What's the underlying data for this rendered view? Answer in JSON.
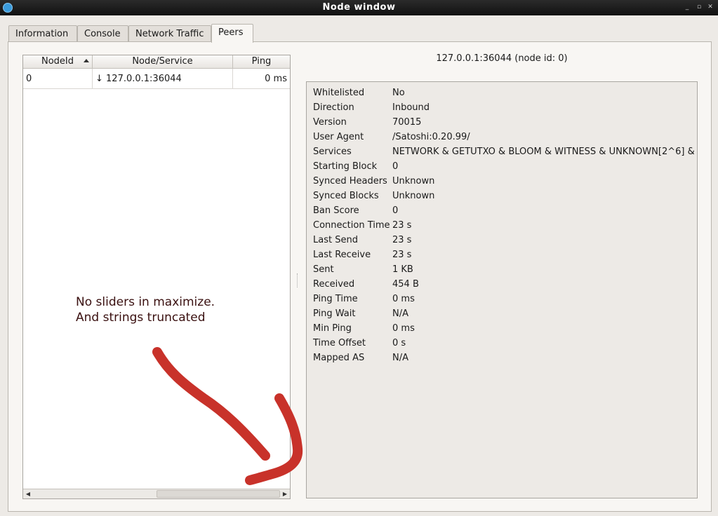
{
  "window": {
    "title": "Node window",
    "controls": [
      "_",
      "▫",
      "✕"
    ]
  },
  "tabs": [
    {
      "label": "Information"
    },
    {
      "label": "Console"
    },
    {
      "label": "Network Traffic"
    },
    {
      "label": "Peers"
    }
  ],
  "peers_table": {
    "columns": [
      "NodeId",
      "Node/Service",
      "Ping"
    ],
    "rows": [
      {
        "node_id": "0",
        "service": "↓ 127.0.0.1:36044",
        "ping": "0 ms"
      }
    ]
  },
  "peer_detail": {
    "heading": "127.0.0.1:36044 (node id: 0)",
    "fields": [
      {
        "label": "Whitelisted",
        "value": "No"
      },
      {
        "label": "Direction",
        "value": "Inbound"
      },
      {
        "label": "Version",
        "value": "70015"
      },
      {
        "label": "User Agent",
        "value": "/Satoshi:0.20.99/"
      },
      {
        "label": "Services",
        "value": "NETWORK & GETUTXO & BLOOM & WITNESS & UNKNOWN[2^6] &"
      },
      {
        "label": "Starting Block",
        "value": "0"
      },
      {
        "label": "Synced Headers",
        "value": "Unknown"
      },
      {
        "label": "Synced Blocks",
        "value": "Unknown"
      },
      {
        "label": "Ban Score",
        "value": "0"
      },
      {
        "label": "Connection Time",
        "value": "23 s"
      },
      {
        "label": "Last Send",
        "value": "23 s"
      },
      {
        "label": "Last Receive",
        "value": "23 s"
      },
      {
        "label": "Sent",
        "value": "1 KB"
      },
      {
        "label": "Received",
        "value": "454 B"
      },
      {
        "label": "Ping Time",
        "value": "0 ms"
      },
      {
        "label": "Ping Wait",
        "value": "N/A"
      },
      {
        "label": "Min Ping",
        "value": "0 ms"
      },
      {
        "label": "Time Offset",
        "value": "0 s"
      },
      {
        "label": "Mapped AS",
        "value": "N/A"
      }
    ]
  },
  "annotation": {
    "line1": "No sliders in maximize.",
    "line2": "And strings truncated",
    "color": "#c8322a"
  }
}
